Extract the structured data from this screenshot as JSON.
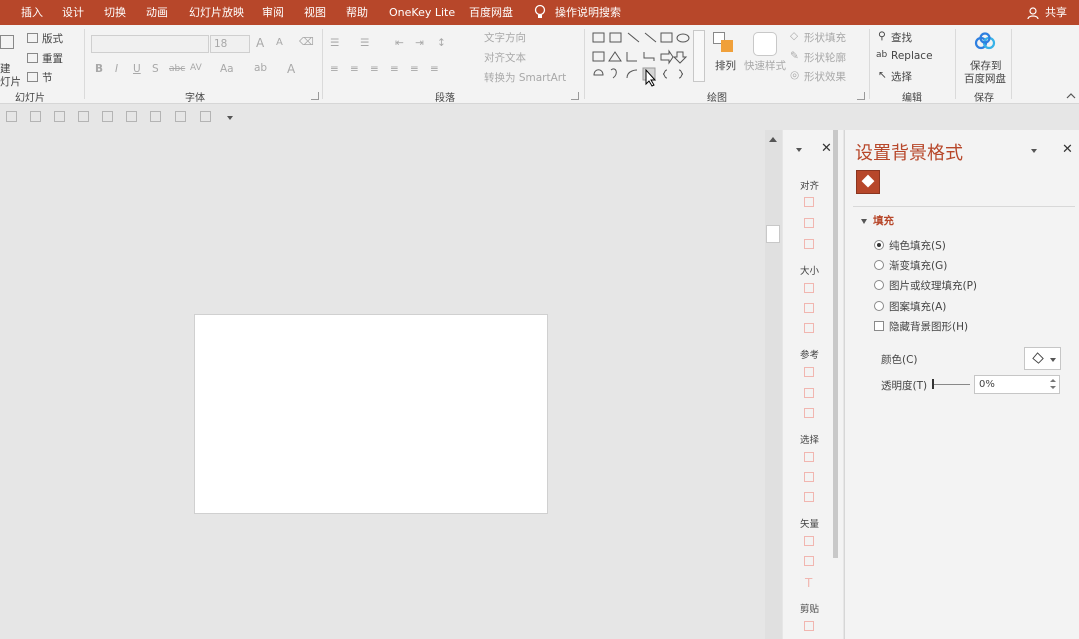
{
  "menu": {
    "tabs": [
      "插入",
      "设计",
      "切换",
      "动画",
      "幻灯片放映",
      "审阅",
      "视图",
      "帮助",
      "OneKey Lite",
      "百度网盘"
    ],
    "search": "操作说明搜索",
    "share": "共享"
  },
  "ribbon": {
    "slides": {
      "new_slide": "建",
      "new_slide_2": "灯片",
      "layout": "版式",
      "reset": "重置",
      "section": "节",
      "label": "幻灯片"
    },
    "font": {
      "size": "18",
      "bold": "B",
      "italic": "I",
      "underline": "U",
      "shadow": "S",
      "strike": "abc",
      "spacing": "AV",
      "case": "Aa",
      "label": "字体"
    },
    "paragraph": {
      "text_direction": "文字方向",
      "align_text": "对齐文本",
      "smartart": "转换为 SmartArt",
      "label": "段落"
    },
    "drawing": {
      "arrange": "排列",
      "quick_styles": "快速样式",
      "shape_fill": "形状填充",
      "shape_outline": "形状轮廓",
      "shape_effects": "形状效果",
      "label": "绘图"
    },
    "editing": {
      "find": "查找",
      "replace": "Replace",
      "select": "选择",
      "label": "编辑"
    },
    "save": {
      "line1": "保存到",
      "line2": "百度网盘",
      "label": "保存"
    }
  },
  "align_pane": {
    "sections": [
      "对齐",
      "大小",
      "参考",
      "选择",
      "矢量",
      "剪贴"
    ]
  },
  "format_pane": {
    "title": "设置背景格式",
    "section": "填充",
    "options": [
      {
        "label": "纯色填充(S)",
        "selected": true
      },
      {
        "label": "渐变填充(G)",
        "selected": false
      },
      {
        "label": "图片或纹理填充(P)",
        "selected": false
      },
      {
        "label": "图案填充(A)",
        "selected": false
      }
    ],
    "hide_bg": "隐藏背景图形(H)",
    "color_label": "颜色(C)",
    "transparency_label": "透明度(T)",
    "transparency_value": "0%"
  }
}
